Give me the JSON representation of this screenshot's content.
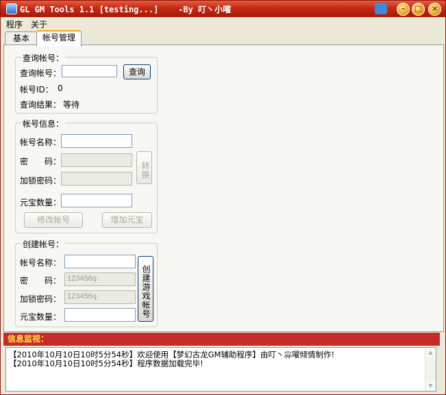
{
  "window": {
    "title": "GL GM Tools 1.1 [testing...]    -By 叮丶小嚁",
    "accent": "#c42a14"
  },
  "titlebar_buttons": {
    "minimize": "–",
    "maximize": "□",
    "close": "×"
  },
  "menu": [
    "程序",
    "关于"
  ],
  "tabs": [
    {
      "label": "基本",
      "active": false
    },
    {
      "label": "帐号管理",
      "active": true
    }
  ],
  "query_group": {
    "title": "查询帐号：",
    "account_label": "查询帐号：",
    "account_value": "",
    "query_button": "查询",
    "id_label": "帐号ID：",
    "id_value": "0",
    "result_label": "查询结果：",
    "result_value": "等待"
  },
  "info_group": {
    "title": "帐号信息：",
    "name_label": "帐号名称：",
    "name_value": "",
    "password_label": "密　　码：",
    "password_value": "",
    "lock_password_label": "加锁密码：",
    "lock_password_value": "",
    "convert_button": "转换",
    "yuanbao_label": "元宝数量：",
    "yuanbao_value": "",
    "modify_button": "修改帐号",
    "add_yuanbao_button": "增加元宝"
  },
  "create_group": {
    "title": "创建帐号：",
    "name_label": "帐号名称：",
    "name_value": "",
    "password_label": "密　　码：",
    "password_value": "123456q",
    "lock_password_label": "加锁密码：",
    "lock_password_value": "123456q",
    "yuanbao_label": "元宝数量：",
    "yuanbao_value": "",
    "create_button": "创建游戏帐号"
  },
  "monitor": {
    "header": "信息监视：",
    "lines": [
      "【2010年10月10日10时5分54秒】欢迎使用【梦幻古龙GM辅助程序】由叮丶尛嚁倾情制作!",
      "【2010年10月10日10时5分54秒】程序数据加载完毕!"
    ]
  }
}
